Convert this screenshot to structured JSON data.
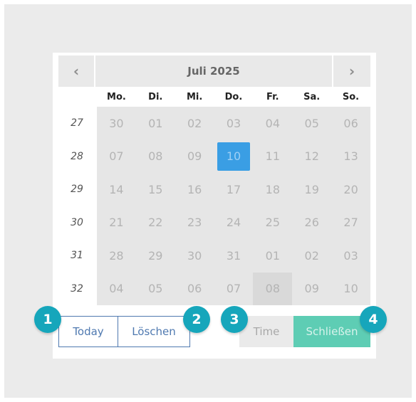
{
  "header": {
    "prev_icon": "‹",
    "next_icon": "›",
    "title": "Juli 2025"
  },
  "weekdays": [
    "Mo.",
    "Di.",
    "Mi.",
    "Do.",
    "Fr.",
    "Sa.",
    "So."
  ],
  "week_numbers": [
    "27",
    "28",
    "29",
    "30",
    "31",
    "32"
  ],
  "weeks": [
    [
      "30",
      "01",
      "02",
      "03",
      "04",
      "05",
      "06"
    ],
    [
      "07",
      "08",
      "09",
      "10",
      "11",
      "12",
      "13"
    ],
    [
      "14",
      "15",
      "16",
      "17",
      "18",
      "19",
      "20"
    ],
    [
      "21",
      "22",
      "23",
      "24",
      "25",
      "26",
      "27"
    ],
    [
      "28",
      "29",
      "30",
      "31",
      "01",
      "02",
      "03"
    ],
    [
      "04",
      "05",
      "06",
      "07",
      "08",
      "09",
      "10"
    ]
  ],
  "selected_day": "10",
  "buttons": {
    "today": "Today",
    "clear": "Löschen",
    "time": "Time",
    "close": "Schließen"
  },
  "badges": [
    "1",
    "2",
    "3",
    "4"
  ],
  "colors": {
    "selected": "#3a9ee4",
    "outline_button": "#4f79b0",
    "close_button": "#5ecdb4",
    "badge": "#16a6bb"
  }
}
